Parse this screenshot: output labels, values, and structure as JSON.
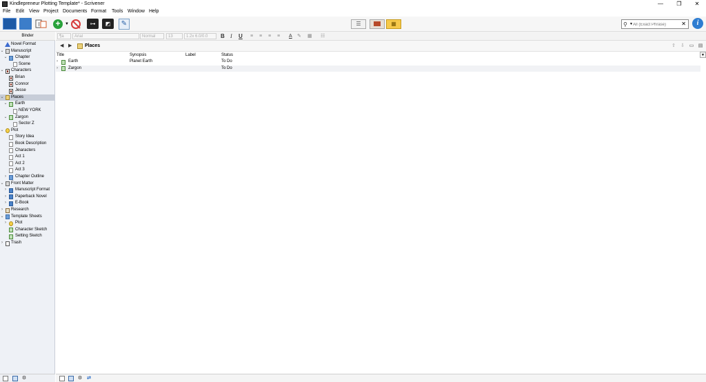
{
  "window": {
    "title": "Kindlepreneur Plotting Template* - Scrivener",
    "minimize": "—",
    "restore": "❐",
    "close": "✕"
  },
  "menu": [
    "File",
    "Edit",
    "View",
    "Project",
    "Documents",
    "Format",
    "Tools",
    "Window",
    "Help"
  ],
  "toolbar": {
    "search_placeholder": "All (Exact Phrase)",
    "search_icon": "search-icon",
    "info_label": "i"
  },
  "format_bar": {
    "style": "¶a",
    "font": "Arial",
    "typeface": "Normal",
    "size": "13",
    "spacing": "1.2x 6.0/0.0",
    "bold": "B",
    "italic": "I",
    "underline": "U"
  },
  "binder": {
    "header": "Binder",
    "items": [
      {
        "label": "Novel Format",
        "icon": "info-triangle-icon"
      },
      {
        "label": "Manuscript",
        "icon": "manuscript-icon"
      },
      {
        "label": "Chapter",
        "icon": "folder-icon"
      },
      {
        "label": "Scene",
        "icon": "document-icon"
      },
      {
        "label": "Characters",
        "icon": "characters-folder-icon"
      },
      {
        "label": "Brian",
        "icon": "character-sheet-icon"
      },
      {
        "label": "Connor",
        "icon": "character-sheet-icon"
      },
      {
        "label": "Jesse",
        "icon": "character-sheet-icon"
      },
      {
        "label": "Places",
        "icon": "places-folder-icon"
      },
      {
        "label": "Earth",
        "icon": "stack-icon"
      },
      {
        "label": "NEW YORK",
        "icon": "document-icon"
      },
      {
        "label": "Zargon",
        "icon": "stack-icon"
      },
      {
        "label": "Sector Z",
        "icon": "document-icon"
      },
      {
        "label": "Plot",
        "icon": "lightbulb-icon"
      },
      {
        "label": "Story Idea",
        "icon": "document-icon"
      },
      {
        "label": "Book Description",
        "icon": "document-icon"
      },
      {
        "label": "Characters",
        "icon": "document-icon"
      },
      {
        "label": "Act 1",
        "icon": "document-icon"
      },
      {
        "label": "Act 2",
        "icon": "document-icon"
      },
      {
        "label": "Act 3",
        "icon": "document-icon"
      },
      {
        "label": "Chapter Outline",
        "icon": "folder-icon"
      },
      {
        "label": "Front Matter",
        "icon": "manuscript-icon"
      },
      {
        "label": "Manuscript Format",
        "icon": "book-icon"
      },
      {
        "label": "Paperback Novel",
        "icon": "book-icon"
      },
      {
        "label": "E-Book",
        "icon": "book-icon"
      },
      {
        "label": "Research",
        "icon": "research-icon"
      },
      {
        "label": "Template Sheets",
        "icon": "template-icon"
      },
      {
        "label": "Plot",
        "icon": "lightbulb-icon"
      },
      {
        "label": "Character Sketch",
        "icon": "stack-icon"
      },
      {
        "label": "Setting Sketch",
        "icon": "stack-icon"
      },
      {
        "label": "Trash",
        "icon": "trash-icon"
      }
    ]
  },
  "editor": {
    "title": "Places",
    "columns": {
      "title": "Title",
      "synopsis": "Synopsis",
      "label": "Label",
      "status": "Status"
    },
    "rows": [
      {
        "title": "Earth",
        "synopsis": "Planet Earth",
        "label": "",
        "status": "To Do"
      },
      {
        "title": "Zargon",
        "synopsis": "",
        "label": "",
        "status": "To Do"
      }
    ]
  },
  "colors": {
    "accent": "#2e7dd1",
    "selection": "#c7cdd8",
    "view_mode_active": "#f6c94a"
  }
}
